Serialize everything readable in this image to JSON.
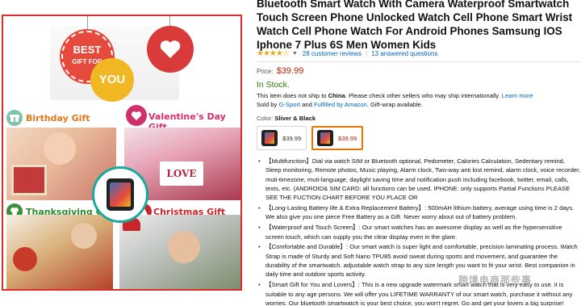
{
  "gallery": {
    "banner_best": "BEST",
    "banner_gift_for": "GIFT FOR",
    "banner_you": "YOU",
    "card_text": "LOVE",
    "labels": {
      "birthday": "Birthday Gift",
      "valentines": "Valentine's Day Gift",
      "thanksgiving": "Thanksgiving Gift",
      "christmas": "Christmas Gift"
    },
    "colors": {
      "border": "#d9302c",
      "accent_red": "#e64a3c",
      "accent_yellow": "#f2b824"
    }
  },
  "product": {
    "title": "Bluetooth Smart Watch With Camera Waterproof Smartwatch Touch Screen Phone Unlocked Watch Cell Phone Smart Wrist Watch Cell Phone Watch For Android Phones Samsung IOS Iphone 7 Plus 6S Men Women Kids",
    "stars": "★★★★☆",
    "reviews_link": "28 customer reviews",
    "separator": "|",
    "questions_link": "13 answered questions",
    "price_label": "Price:",
    "price": "$39.99",
    "stock": "In Stock.",
    "ship_note_prefix": "This item does not ship to ",
    "ship_country": "China",
    "ship_note_suffix": ". Please check other sellers who may ship internationally.",
    "learn_more": "Learn more",
    "sold_by_prefix": "Sold by ",
    "seller": "G-Sport",
    "and_text": " and ",
    "fulfilled": "Fulfilled by Amazon",
    "gift_wrap": ". Gift-wrap available.",
    "color_label": "Color:",
    "color_value": "Sliver & Black",
    "swatches": [
      {
        "price": "$39.99"
      },
      {
        "price": "$39.99"
      }
    ],
    "colors": {
      "price": "#b12704",
      "link": "#0066c0",
      "stock": "#2f7a0a",
      "selected_border": "#e77600"
    }
  },
  "bullets": [
    "【Multifunction】Dial via watch SIM or Bluetooth optional, Pedometer, Calories Calculation, Sedentary remind, Sleep monitoring, Remote photos, Music playing, Alarm clock, Two-way anti lost remind, alarm clock, voice recorder, muti-timezone, muti-language, daylight saving time and notification push including facebook, twitter, email, calls, texts, etc. (ANDROID& SIM CARD: all functions can be used. IPHONE: only supports Partial Functions PLEASE SEE THE FUCTION CHART BEFORE YOU PLACE OR",
    "【Long-Lasting Battery life & Extra Replacement Battery】: 500mAH lithium battery, average using time is 2 days. We also give you one piece Free Battery as a Gift. Never worry about out of battery problem.",
    "【Waterproof and Touch Screen】: Our smart watches has an awesome display as well as the hypersensitive screen touch, which can supply you the clear display even in the glare.",
    "【Comfortable and Durable】: Our smart watch is super light and comfortable, precision laminating process. Watch Strap is made of Sturdy and Soft Nano TPU85 avoid sweat during sports and movement, and guarantee the durability of the smartwatch. adjustable watch strap to any size length you want to fit your wrist. Best companion in daily time and outdoor sports activity.",
    "【Smart Gift for You and Lovers】: This is a new upgrade watermark smart watch that is very easy to use. it is suitable to any age persons. We will offer you LIFETIME WARRANTY of our smart watch, purchase it without any worries. Our bluetooth smartwatch is your best choice, you won't regret. Go and get your lovers a big surprise!"
  ],
  "watermark": "跨境电商那些事"
}
